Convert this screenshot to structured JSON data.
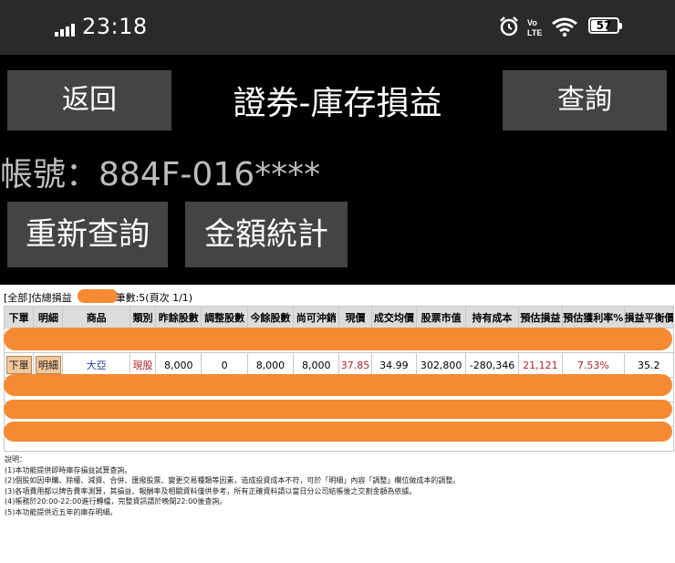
{
  "status_bar": {
    "time": "23:18",
    "battery_level": "57",
    "icons": [
      "signal-icon",
      "alarm-icon",
      "volte-icon",
      "wifi-icon",
      "battery-icon"
    ]
  },
  "header": {
    "back_label": "返回",
    "title": "證券-庫存損益",
    "query_label": "查詢"
  },
  "account": {
    "text": "帳號：884F-016****"
  },
  "actions": {
    "requery_label": "重新查詢",
    "stats_label": "金額統計"
  },
  "summary": {
    "prefix": "[全部]估總損益",
    "suffix": "筆數:5(頁次 1/1)"
  },
  "table": {
    "headers": [
      "下單",
      "明細",
      "商品",
      "類別",
      "昨餘股數",
      "調整股數",
      "今餘股數",
      "尚可沖銷",
      "現價",
      "成交均價",
      "股票市值",
      "持有成本",
      "預估損益",
      "預估獲利率%",
      "損益平衡價"
    ],
    "row": {
      "order_btn": "下單",
      "detail_btn": "明細",
      "product": "大亞",
      "category": "現股",
      "prev_shares": "8,000",
      "adjust_shares": "0",
      "today_shares": "8,000",
      "offsettable": "8,000",
      "price": "37.85",
      "avg_price": "34.99",
      "market_value": "302,800",
      "cost": "-280,346",
      "est_pnl": "21,121",
      "est_rate": "7.53%",
      "breakeven": "35.2"
    }
  },
  "notes": {
    "title": "說明：",
    "lines": [
      "(1)本功能提供即時庫存損益試算查詢。",
      "(2)個股如因申購、除權、減資、合併、匯撥股票、變更交易種類等因素，造成投資成本不符，可於「明細」內容「調整」欄位做成本的調整。",
      "(3)各項費用都以牌告費率測算，其損益、報酬率及相關資料僅供參考，所有正確資料請以當日分公司結帳後之交割金額為依據。",
      "(4)帳務於20:00-22:00進行轉檔，完整資訊請於晚間22:00後查詢。",
      "(5)本功能提供近五年的庫存明細。"
    ]
  },
  "colors": {
    "redaction": "#f58a33",
    "button_bg": "#444444",
    "value_red": "#b52424",
    "value_blue": "#1f3fa7"
  }
}
